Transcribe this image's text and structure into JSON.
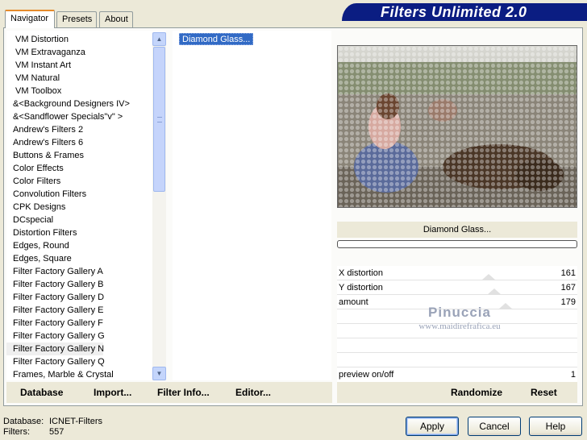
{
  "banner": {
    "title": "Filters Unlimited 2.0"
  },
  "tabs": [
    {
      "label": "Navigator",
      "active": true
    },
    {
      "label": "Presets",
      "active": false
    },
    {
      "label": "About",
      "active": false
    }
  ],
  "categories": [
    "VM Distortion",
    "VM Extravaganza",
    "VM Instant Art",
    "VM Natural",
    "VM Toolbox",
    "&<Background Designers IV>",
    "&<Sandflower Specials\"v\" >",
    "Andrew's Filters 2",
    "Andrew's Filters 6",
    "Buttons & Frames",
    "Color Effects",
    "Color Filters",
    "Convolution Filters",
    "CPK Designs",
    "DCspecial",
    "Distortion Filters",
    "Edges, Round",
    "Edges, Square",
    "Filter Factory Gallery A",
    "Filter Factory Gallery B",
    "Filter Factory Gallery D",
    "Filter Factory Gallery E",
    "Filter Factory Gallery F",
    "Filter Factory Gallery G",
    "Filter Factory Gallery N",
    "Filter Factory Gallery Q",
    "Frames, Marble & Crystal"
  ],
  "selected_category": "Filter Factory Gallery N",
  "filters": [
    "Diamond Glass..."
  ],
  "filter_caption": "Diamond Glass...",
  "parameters": [
    {
      "label": "X distortion",
      "value": "161",
      "level": 161
    },
    {
      "label": "Y distortion",
      "value": "167",
      "level": 167
    },
    {
      "label": "amount",
      "value": "179",
      "level": 179
    }
  ],
  "preview_toggle": {
    "label": "preview on/off",
    "value": "1"
  },
  "watermark": {
    "name": "Pinuccia",
    "site": "www.maidirefrafica.eu"
  },
  "toolbar": {
    "database": "Database",
    "import": "Import...",
    "filter_info": "Filter Info...",
    "editor": "Editor...",
    "randomize": "Randomize",
    "reset": "Reset"
  },
  "status": {
    "database_label": "Database:",
    "database_value": "ICNET-Filters",
    "filters_label": "Filters:",
    "filters_value": "557"
  },
  "buttons": {
    "apply": "Apply",
    "cancel": "Cancel",
    "help": "Help"
  },
  "colors": {
    "banner": "#0b1d82",
    "selection": "#316ac5",
    "tab_accent": "#e68b2c"
  }
}
